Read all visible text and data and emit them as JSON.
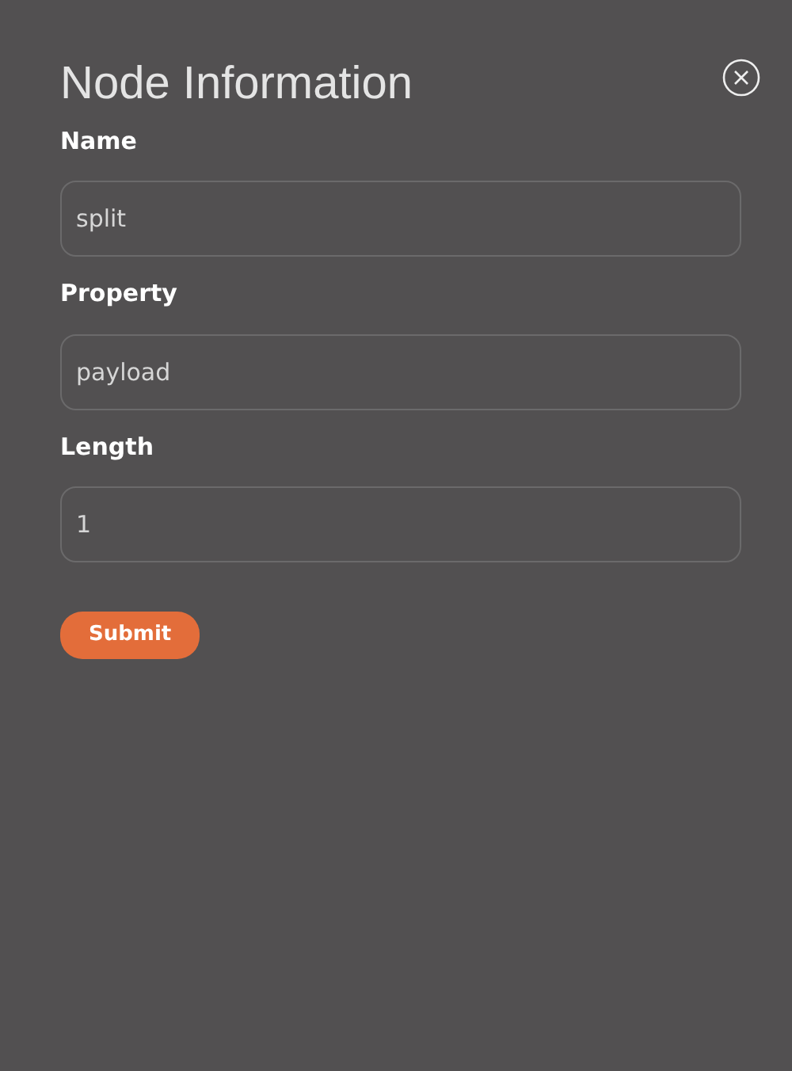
{
  "title": "Node Information",
  "fields": [
    {
      "label": "Name",
      "value": "split"
    },
    {
      "label": "Property",
      "value": "payload"
    },
    {
      "label": "Length",
      "value": "1"
    }
  ],
  "submit": "Submit"
}
